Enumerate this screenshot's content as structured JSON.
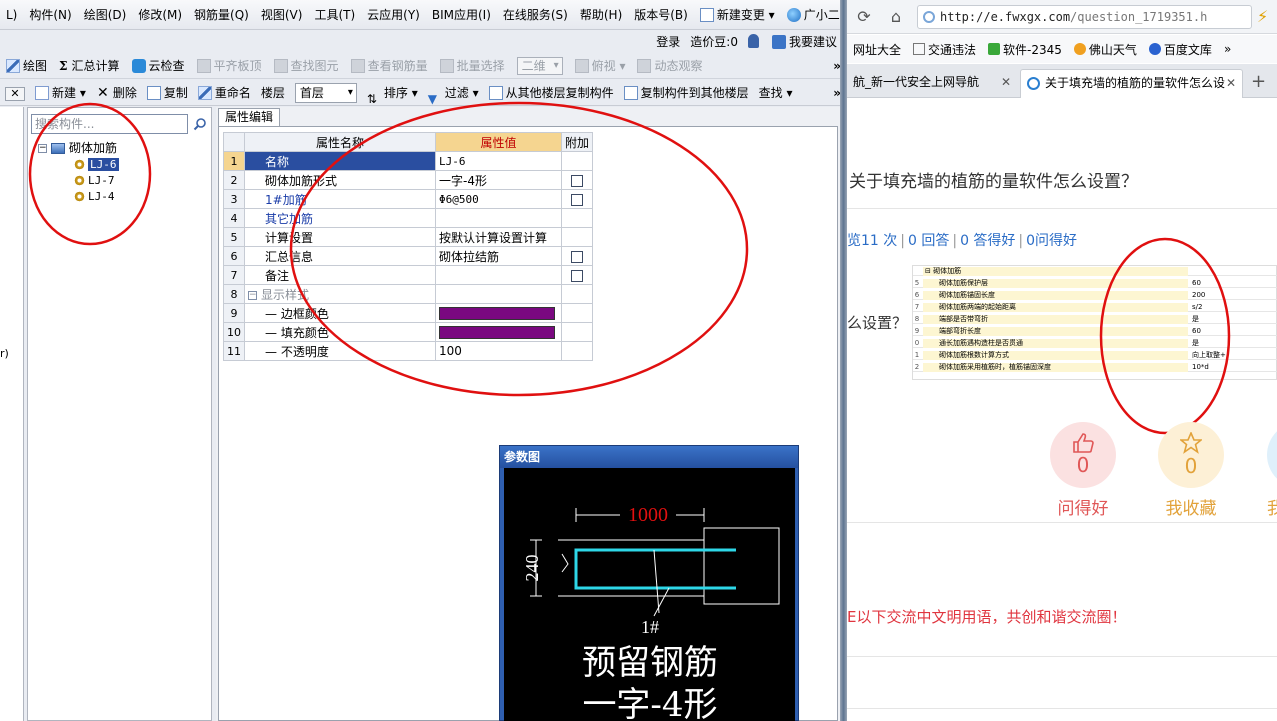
{
  "app": {
    "menu": [
      {
        "label": "L)"
      },
      {
        "label": "构件(N)"
      },
      {
        "label": "绘图(D)"
      },
      {
        "label": "修改(M)"
      },
      {
        "label": "钢筋量(Q)"
      },
      {
        "label": "视图(V)"
      },
      {
        "label": "工具(T)"
      },
      {
        "label": "云应用(Y)"
      },
      {
        "label": "BIM应用(I)"
      },
      {
        "label": "在线服务(S)"
      },
      {
        "label": "帮助(H)"
      },
      {
        "label": "版本号(B)"
      },
      {
        "label": "新建变更 ▾"
      },
      {
        "label": "广小二"
      }
    ],
    "loginbar": {
      "login": "登录",
      "price_bean": "造价豆:0",
      "suggest": "我要建议"
    },
    "toolbar1": {
      "draw": "绘图",
      "summary": "汇总计算",
      "cloud_check": "云检查",
      "flat_slab": "平齐板顶",
      "find_element": "查找图元",
      "view_rebar": "查看钢筋量",
      "batch_select": "批量选择",
      "view_2d": "二维",
      "view_top": "俯视",
      "dynamic_view": "动态观察",
      "more": "»"
    },
    "toolbar2": {
      "new": "新建",
      "delete": "删除",
      "copy": "复制",
      "rename": "重命名",
      "floor_label": "楼层",
      "floor_value": "首层",
      "sort": "排序",
      "filter": "过滤",
      "copy_from": "从其他楼层复制构件",
      "copy_to": "复制构件到其他楼层",
      "find": "查找",
      "more": "»",
      "close": "✕"
    },
    "tree": {
      "search_placeholder": "搜索构件...",
      "root": "砌体加筋",
      "children": [
        "LJ-6",
        "LJ-7",
        "LJ-4"
      ]
    },
    "left_strip_char": "r)",
    "property": {
      "tab": "属性编辑",
      "headers": {
        "name": "属性名称",
        "value": "属性值",
        "extra": "附加"
      },
      "rows": [
        {
          "num": "1",
          "name": "名称",
          "value": "LJ-6",
          "checkbox": false
        },
        {
          "num": "2",
          "name": "砌体加筋形式",
          "value": "一字-4形",
          "checkbox": true
        },
        {
          "num": "3",
          "name": "1#加筋",
          "value": "Φ6@500",
          "checkbox": true
        },
        {
          "num": "4",
          "name": "其它加筋",
          "value": "",
          "checkbox": false
        },
        {
          "num": "5",
          "name": "计算设置",
          "value": "按默认计算设置计算",
          "checkbox": false
        },
        {
          "num": "6",
          "name": "汇总信息",
          "value": "砌体拉结筋",
          "checkbox": true
        },
        {
          "num": "7",
          "name": "备注",
          "value": "",
          "checkbox": true
        },
        {
          "num": "8",
          "name": "显示样式",
          "value": "",
          "checkbox": false
        },
        {
          "num": "9",
          "name": "边框颜色",
          "value": "",
          "checkbox": false
        },
        {
          "num": "10",
          "name": "填充颜色",
          "value": "",
          "checkbox": false
        },
        {
          "num": "11",
          "name": "不透明度",
          "value": "100",
          "checkbox": false
        }
      ],
      "swatch_color": "#7a0880"
    },
    "param_window": {
      "title": "参数图",
      "dim_length": "1000",
      "dim_width": "240",
      "rebar_label": "1#",
      "caption_line1": "预留钢筋",
      "caption_line2": "一字-4形"
    }
  },
  "browser": {
    "url_host": "http://e.fwxgx.com",
    "url_path": "/question_1719351.h",
    "bookmarks": [
      "网址大全",
      "交通违法",
      "软件-2345",
      "佛山天气",
      "百度文库",
      "»"
    ],
    "tabs": [
      {
        "title": "航_新一代安全上网导航"
      },
      {
        "title": "关于填充墙的植筋的量软件怎么设"
      }
    ],
    "question": "关于填充墙的植筋的量软件怎么设置？",
    "stats": {
      "views": "览11 次",
      "answers": "0 回答",
      "good_answers": "0 答得好",
      "good_questions": "0问得好"
    },
    "snippet": "么设置？",
    "thumb_rows": [
      {
        "n": "",
        "k": "⊟ 砌体加筋",
        "v": ""
      },
      {
        "n": "5",
        "k": "砌体加筋保护层",
        "v": "60"
      },
      {
        "n": "6",
        "k": "砌体加筋锚固长度",
        "v": "200"
      },
      {
        "n": "7",
        "k": "砌体加筋两端的起始距离",
        "v": "s/2"
      },
      {
        "n": "8",
        "k": "端部是否带弯折",
        "v": "是"
      },
      {
        "n": "9",
        "k": "端部弯折长度",
        "v": "60"
      },
      {
        "n": "0",
        "k": "通长加筋遇构造柱是否贯通",
        "v": "是"
      },
      {
        "n": "1",
        "k": "砌体加筋根数计算方式",
        "v": "向上取整+"
      },
      {
        "n": "2",
        "k": "砌体加筋采用植筋时，植筋锚固深度",
        "v": "10*d"
      }
    ],
    "actions": [
      {
        "count": "0",
        "label": "问得好"
      },
      {
        "count": "0",
        "label": "我收藏"
      },
      {
        "count": "",
        "label": "我"
      }
    ],
    "notice": "E以下交流中文明用语，共创和谐交流圈！",
    "colors": {
      "link": "#2a6cc6",
      "good": "#e05757",
      "fav": "#e2a23a",
      "notice": "#e0353f"
    }
  }
}
